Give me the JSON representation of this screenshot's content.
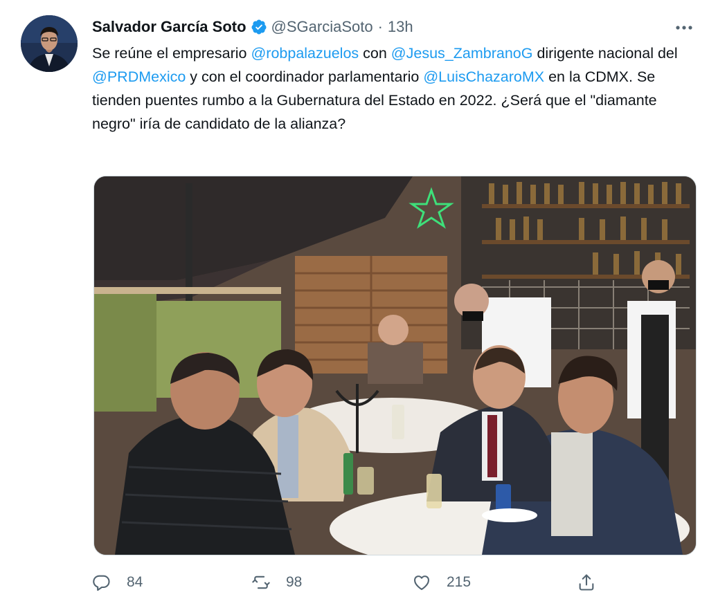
{
  "tweet": {
    "author_name": "Salvador García Soto",
    "handle": "@SGarciaSoto",
    "separator": "·",
    "time": "13h",
    "text_segments": [
      {
        "text": "Se reúne el empresario ",
        "mention": false
      },
      {
        "text": "@robpalazuelos",
        "mention": true
      },
      {
        "text": " con ",
        "mention": false
      },
      {
        "text": "@Jesus_ZambranoG",
        "mention": true
      },
      {
        "text": " dirigente nacional del ",
        "mention": false
      },
      {
        "text": "@PRDMexico",
        "mention": true
      },
      {
        "text": " y con el coordinador parlamentario ",
        "mention": false
      },
      {
        "text": "@LuisChazaroMX",
        "mention": true
      },
      {
        "text": " en la CDMX. Se tienden puentes rumbo a la Gubernatura del Estado en 2022. ¿Será que el \"diamante negro\" iría de candidato de la alianza?",
        "mention": false
      }
    ]
  },
  "actions": {
    "reply_count": "84",
    "retweet_count": "98",
    "like_count": "215"
  },
  "icons": {
    "verified": "verified-badge-icon",
    "more": "more-options-icon",
    "reply": "reply-icon",
    "retweet": "retweet-icon",
    "like": "like-icon",
    "share": "share-icon"
  },
  "colors": {
    "link": "#1d9bf0",
    "secondary_text": "#536471",
    "primary_text": "#0f1419",
    "border": "#cfd9de"
  }
}
